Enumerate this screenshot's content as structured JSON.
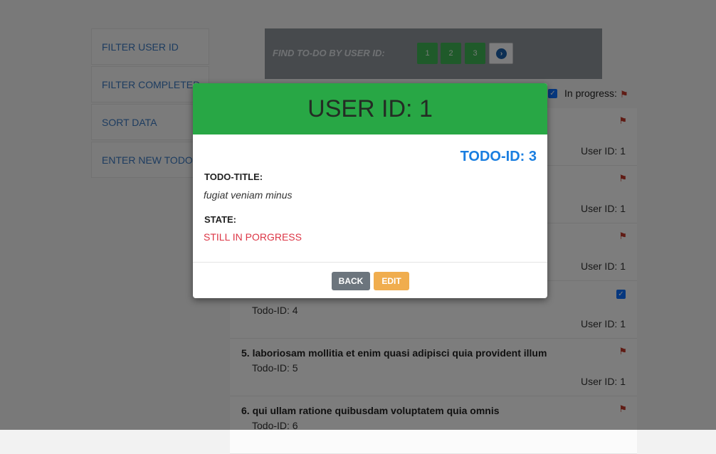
{
  "sidebar": {
    "items": [
      {
        "label": "FILTER USER ID"
      },
      {
        "label": "FILTER COMPLETED"
      },
      {
        "label": "SORT DATA"
      },
      {
        "label": "ENTER NEW TODO"
      }
    ]
  },
  "find": {
    "label": "FIND TO-DO BY USER ID:",
    "pages": [
      "1",
      "2",
      "3"
    ],
    "next_icon": "chevron-right-circle-icon"
  },
  "legend": {
    "in_progress_label": "In progress:",
    "completed_icon": "checkbox-checked-icon",
    "in_progress_icon": "flag-icon"
  },
  "todos": [
    {
      "title": "",
      "id_text": "",
      "user_text": "User ID: 1",
      "status": "in-progress"
    },
    {
      "title": "",
      "id_text": "",
      "user_text": "User ID: 1",
      "status": "in-progress"
    },
    {
      "title": "",
      "id_text": "",
      "user_text": "User ID: 1",
      "status": "in-progress"
    },
    {
      "title": "",
      "id_text": "Todo-ID: 4",
      "user_text": "User ID: 1",
      "status": "completed"
    },
    {
      "title": "5. laboriosam mollitia et enim quasi adipisci quia provident illum",
      "id_text": "Todo-ID: 5",
      "user_text": "User ID: 1",
      "status": "in-progress"
    },
    {
      "title": "6. qui ullam ratione quibusdam voluptatem quia omnis",
      "id_text": "Todo-ID: 6",
      "user_text": "",
      "status": "in-progress"
    }
  ],
  "modal": {
    "header": "USER ID: 1",
    "todo_id": "TODO-ID: 3",
    "title_label": "TODO-TITLE:",
    "title_value": "fugiat veniam minus",
    "state_label": "STATE:",
    "state_value": "STILL IN PORGRESS",
    "back_label": "BACK",
    "edit_label": "EDIT"
  },
  "colors": {
    "header_green": "#28a745",
    "todo_id_blue": "#1a7ee0",
    "state_red": "#dc3545",
    "edit_orange": "#f0ad4e",
    "back_gray": "#6c757d"
  }
}
